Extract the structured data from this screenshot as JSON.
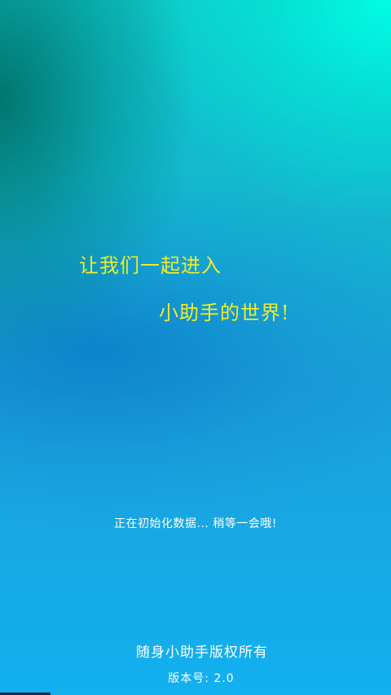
{
  "splash": {
    "slogan_line1": "让我们一起进入",
    "slogan_line2": "小助手的世界!",
    "loading_text": "正在初始化数据... 稍等一会哦!",
    "copyright": "随身小助手版权所有",
    "version": "版本号: 2.0"
  },
  "colors": {
    "slogan": "#f0ec2a",
    "text": "#ffffff",
    "background_top_right": "#00ffe6",
    "background_bottom": "#12b0ef"
  }
}
